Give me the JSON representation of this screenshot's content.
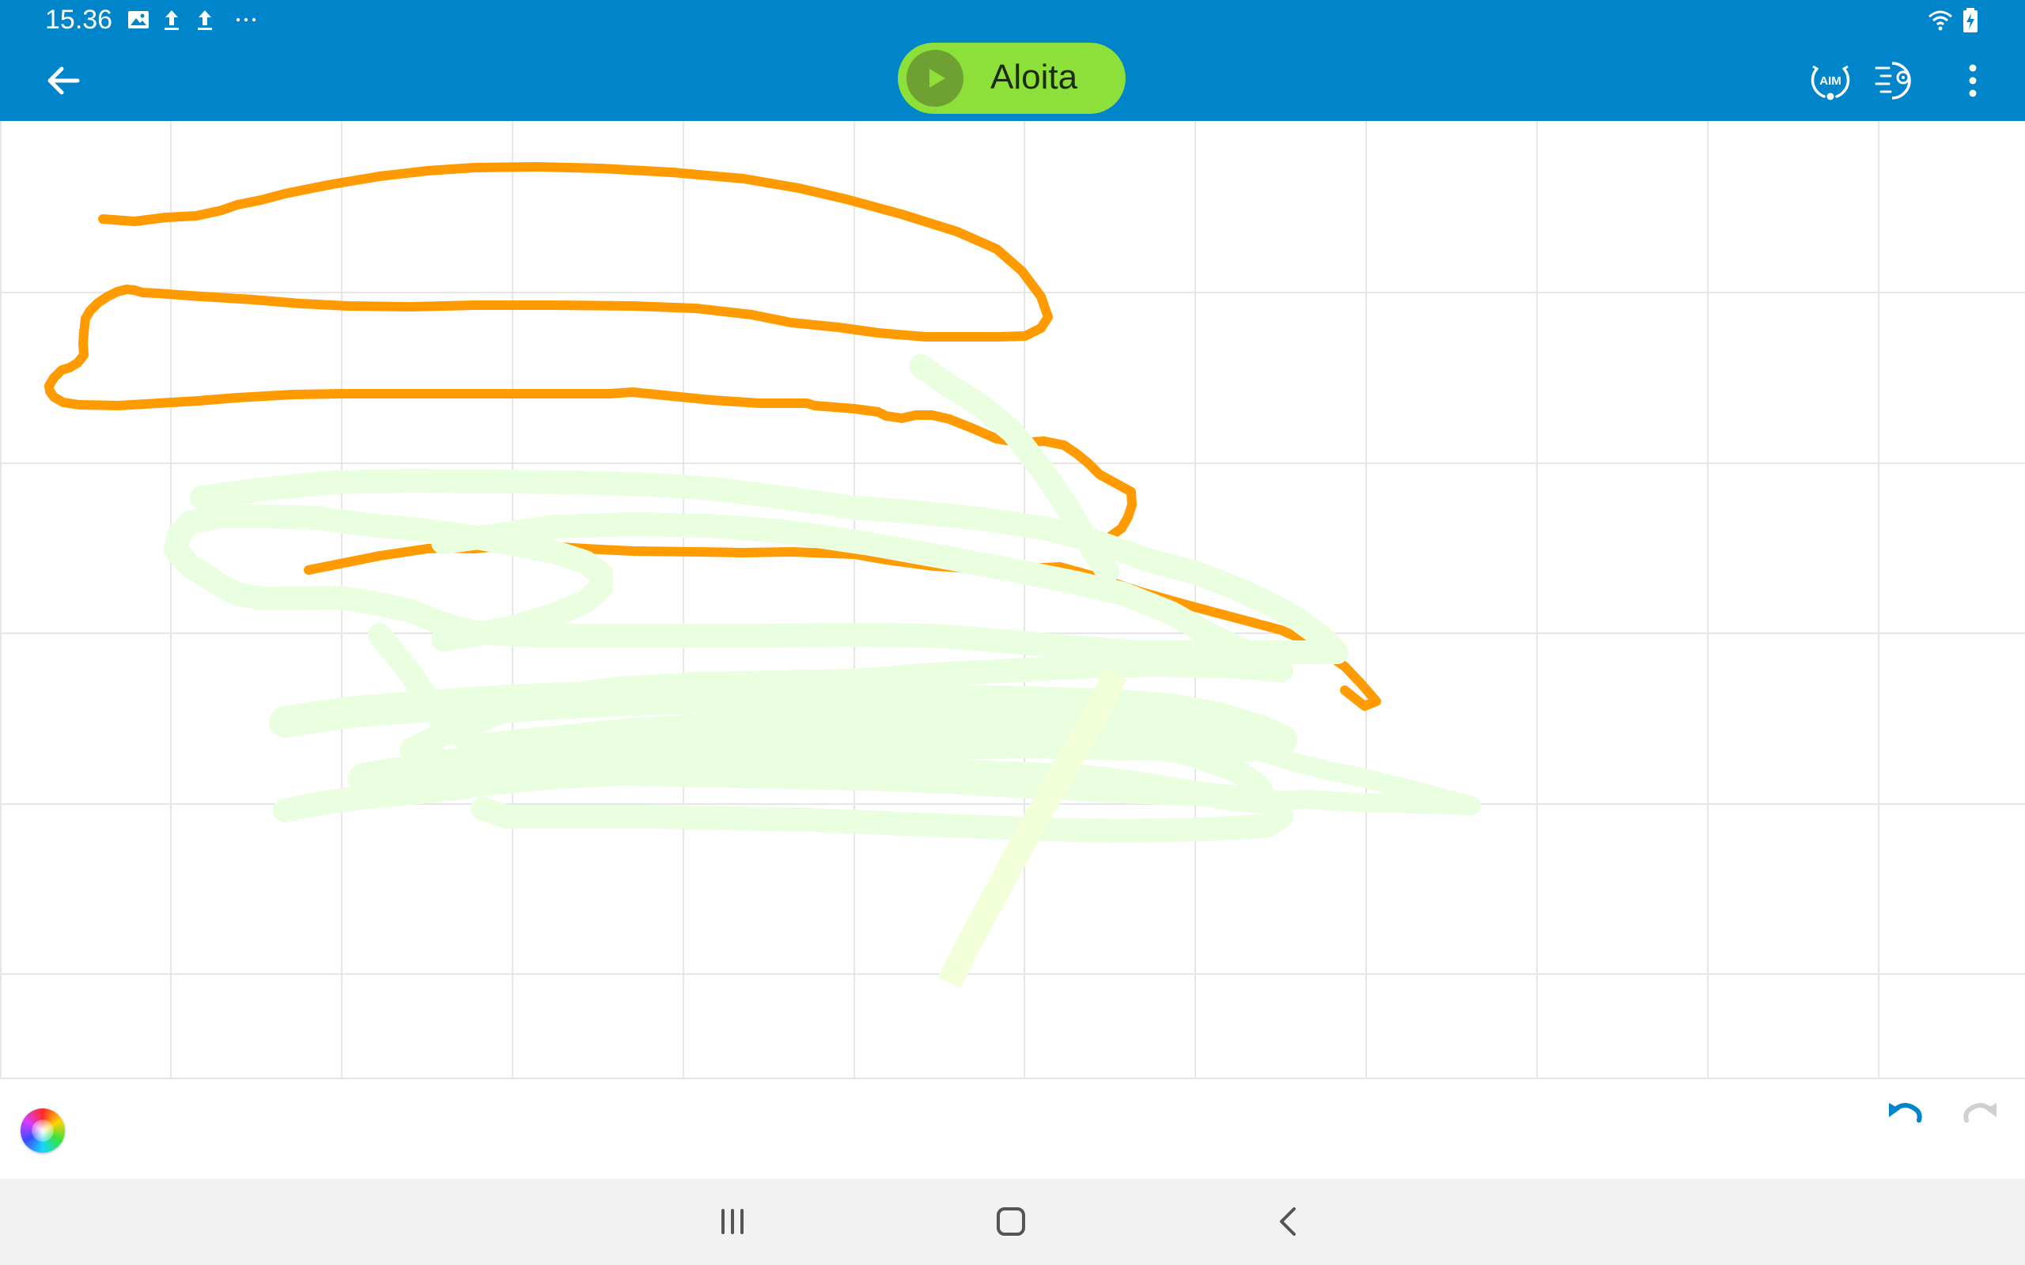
{
  "status_bar": {
    "time": "15.36",
    "left_icons": [
      "image-notification-icon",
      "upload-icon",
      "upload-icon",
      "more-notifications-icon"
    ],
    "right_icons": [
      "wifi-icon",
      "battery-charging-icon"
    ]
  },
  "app_bar": {
    "back_icon": "back-arrow-icon",
    "start_button": {
      "label": "Aloita",
      "icon": "play-icon",
      "color": "#8de03a"
    },
    "aim_icon": {
      "name": "aim-icon",
      "text": "AIM"
    },
    "speed_icon": "speed-heading-icon",
    "menu_icon": "more-vert-icon",
    "color": "#0085ca"
  },
  "drawing": {
    "grid_color": "#e6e6e6",
    "strokes": [
      {
        "color": "#ff9a00"
      },
      {
        "color": "#eafee0"
      },
      {
        "color": "#f3ffd9"
      }
    ]
  },
  "tool_strip": {
    "color_picker_icon": "color-wheel-icon",
    "undo_icon": "undo-icon",
    "redo_icon": "redo-icon",
    "undo_color": "#0085ca",
    "redo_color": "#d0d0d0"
  },
  "nav_bar": {
    "buttons": [
      "recent-apps-icon",
      "home-icon",
      "back-icon"
    ]
  }
}
